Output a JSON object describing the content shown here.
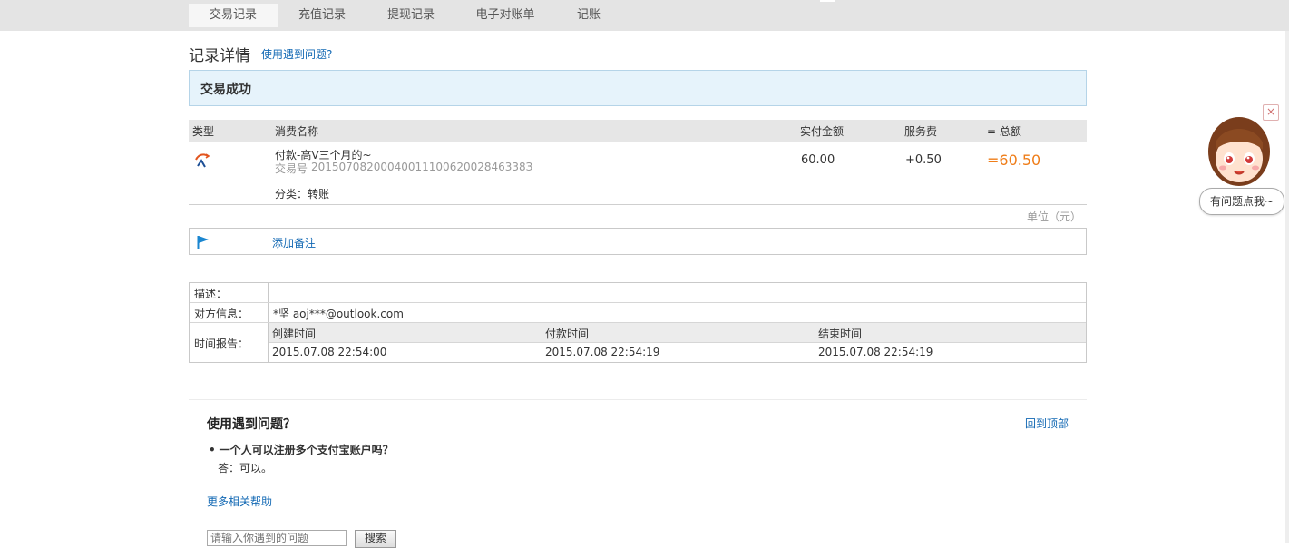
{
  "nav": {
    "tabs": [
      {
        "label": "交易记录",
        "active": true
      },
      {
        "label": "充值记录"
      },
      {
        "label": "提现记录"
      },
      {
        "label": "电子对账单"
      },
      {
        "label": "记账"
      }
    ]
  },
  "header": {
    "title": "记录详情",
    "help_link": "使用遇到问题?"
  },
  "status": {
    "text": "交易成功"
  },
  "table": {
    "headers": {
      "type": "类型",
      "name": "消费名称",
      "amount": "实付金额",
      "fee": "服务费",
      "total": "= 总额"
    },
    "row": {
      "icon": "transfer-icon",
      "name": "付款-高V三个月的~",
      "tx_label": "交易号",
      "tx_id": "2015070820004001110062002846338З",
      "amount": "60.00",
      "fee": "+0.50",
      "total": "=60.50",
      "category": "分类：转账"
    },
    "unit": "单位（元）"
  },
  "note": {
    "label": "添加备注",
    "icon": "flag-icon"
  },
  "info": {
    "desc_label": "描述：",
    "desc_value": "",
    "party_label": "对方信息：",
    "party_value": "*坚 aoj***@outlook.com",
    "time_label": "时间报告：",
    "time_headers": [
      "创建时间",
      "付款时间",
      "结束时间"
    ],
    "time_values": [
      "2015.07.08 22:54:00",
      "2015.07.08 22:54:19",
      "2015.07.08 22:54:19"
    ]
  },
  "faq": {
    "title": "使用遇到问题？",
    "back_to_top": "回到顶部",
    "question": "一个人可以注册多个支付宝账户吗？",
    "answer": "答：可以。",
    "more": "更多相关帮助",
    "search_placeholder": "请输入你遇到的问题",
    "search_button": "搜索"
  },
  "helper": {
    "bubble": "有问题点我~",
    "close": "×"
  },
  "colors": {
    "link": "#1369b4",
    "total": "#ef7d19",
    "status_bg": "#e6f3fb",
    "flag": "#1a86d0"
  }
}
